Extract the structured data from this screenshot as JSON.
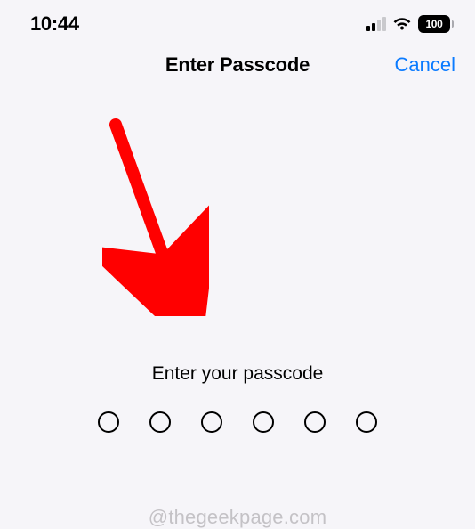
{
  "status_bar": {
    "time": "10:44",
    "battery_level": "100"
  },
  "navigation": {
    "title": "Enter Passcode",
    "cancel_label": "Cancel"
  },
  "content": {
    "watermark": "@thegeekpage.com",
    "prompt": "Enter your passcode",
    "passcode_length": 6
  }
}
